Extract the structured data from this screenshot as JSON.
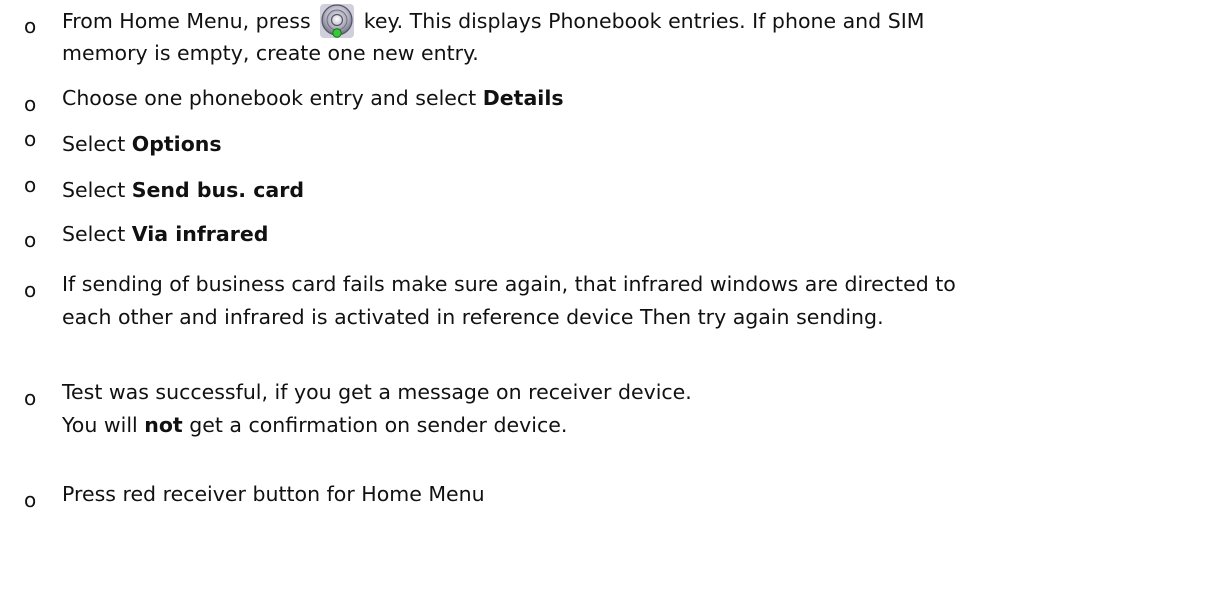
{
  "instructions": {
    "items": [
      {
        "before_icon": "From Home Menu, press ",
        "icon": "navi-key-icon",
        "after_icon": " key. This displays Phonebook entries. If phone and SIM",
        "line2": "memory is empty, create one new entry."
      },
      {
        "text": "Choose one phonebook entry and select ",
        "bold": "Details"
      },
      {
        "text": "Select ",
        "bold": "Options"
      },
      {
        "text": "Select ",
        "bold": "Send bus. card"
      },
      {
        "text": "Select ",
        "bold": "Via infrared"
      },
      {
        "line1": "If sending of business card fails make sure again, that infrared windows are directed to",
        "line2": "each other and infrared is activated in reference device  Then try again sending."
      },
      {
        "line1": "Test was successful, if you get a message on receiver device.",
        "line2_before": "You will ",
        "line2_bold": "not",
        "line2_after": " get a confirmation on sender device."
      },
      {
        "text": "Press red receiver button for Home Menu"
      }
    ],
    "bullet_glyph": "o"
  },
  "colors": {
    "text": "#111111",
    "icon_ring": "#8a8a98",
    "icon_center": "#c8c8d4",
    "icon_dot": "#33cc33"
  }
}
